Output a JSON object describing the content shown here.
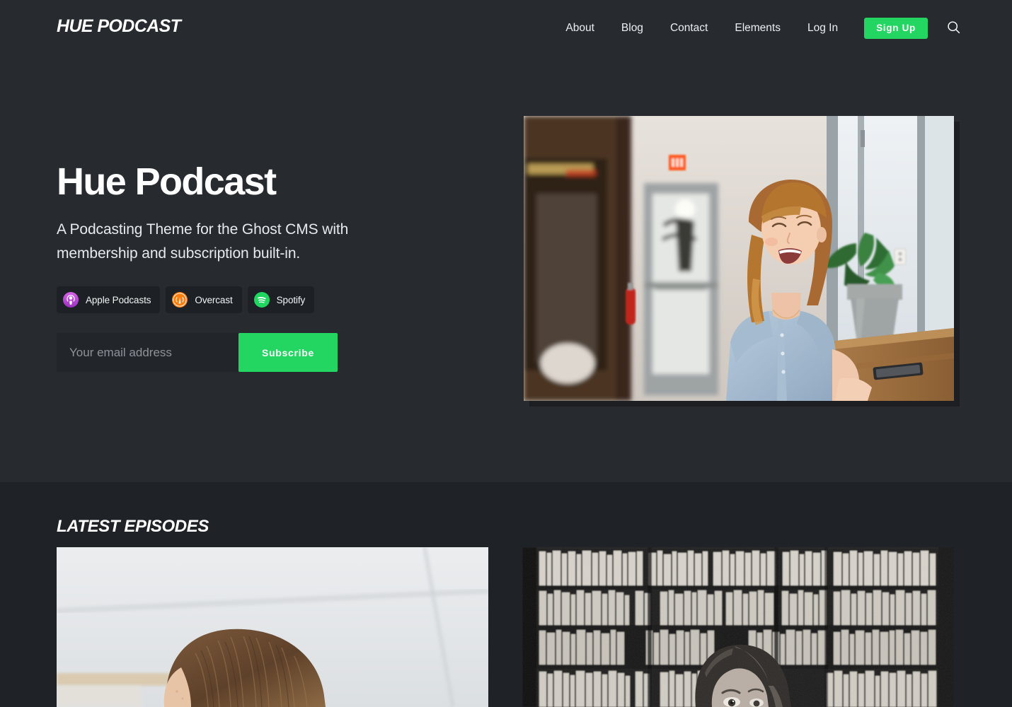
{
  "header": {
    "brand": "HUE PODCAST",
    "nav_links": [
      {
        "label": "About"
      },
      {
        "label": "Blog"
      },
      {
        "label": "Contact"
      },
      {
        "label": "Elements"
      },
      {
        "label": "Log In"
      }
    ],
    "signup_label": "Sign Up",
    "search_icon": "search-icon",
    "accent_color": "#23d661"
  },
  "hero": {
    "title": "Hue Podcast",
    "subtitle": "A Podcasting Theme for the Ghost CMS with membership and subscription built-in.",
    "podcast_links": [
      {
        "label": "Apple Podcasts",
        "icon": "apple-podcasts-icon",
        "color": "#c13cd6"
      },
      {
        "label": "Overcast",
        "icon": "overcast-icon",
        "color": "#fc7e0f"
      },
      {
        "label": "Spotify",
        "icon": "spotify-icon",
        "color": "#1ed760"
      }
    ],
    "subscribe": {
      "email_placeholder": "Your email address",
      "email_value": "",
      "button_label": "Subscribe"
    },
    "image_alt": "Smiling woman in light blue denim shirt leaning on a wooden counter by a cafe window with a potted plant"
  },
  "episodes": {
    "section_title": "LATEST EPISODES",
    "cards": [
      {
        "image_alt": "Top of a person's head with short brown hair against a bright white wall"
      },
      {
        "image_alt": "Black and white photo of a person in front of tall shelves filled with books"
      }
    ]
  },
  "colors": {
    "hero_background": "#272a2e",
    "episodes_background": "#1f2226",
    "badge_background": "#1d2024",
    "input_background": "#22252a",
    "text_primary": "#ffffff",
    "text_secondary": "#e7eaec",
    "placeholder": "#8e9399"
  }
}
